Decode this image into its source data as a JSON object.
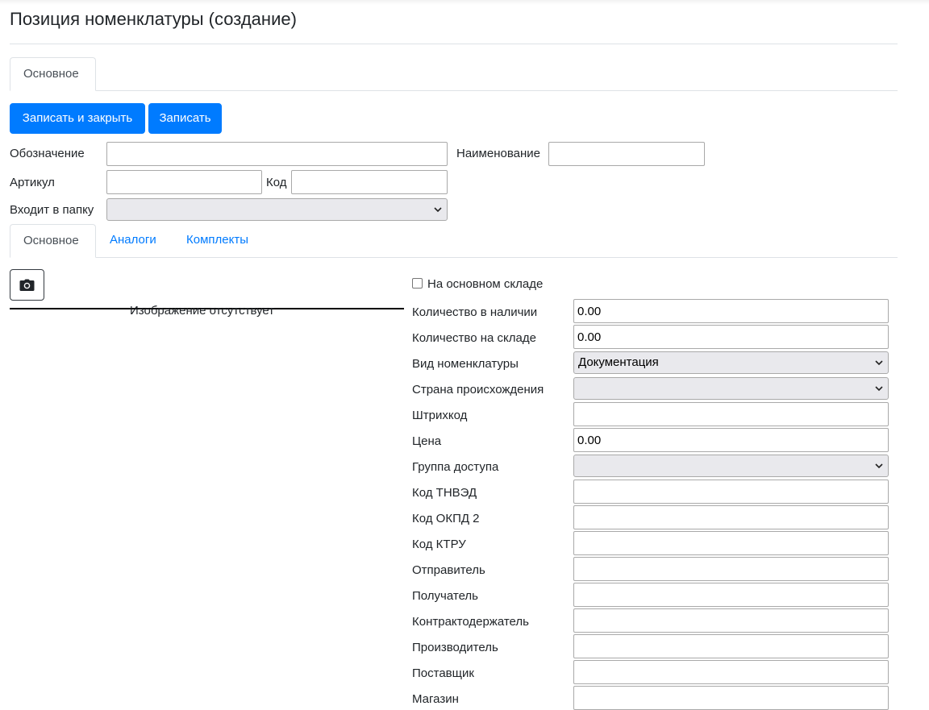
{
  "page": {
    "title": "Позиция номенклатуры (создание)"
  },
  "top_tabs": [
    {
      "label": "Основное"
    }
  ],
  "toolbar": {
    "save_close_label": "Записать и закрыть",
    "save_label": "Записать"
  },
  "header_form": {
    "designation": {
      "label": "Обозначение",
      "value": ""
    },
    "name": {
      "label": "Наименование",
      "value": ""
    },
    "article": {
      "label": "Артикул",
      "value": ""
    },
    "code": {
      "label": "Код",
      "value": ""
    },
    "folder": {
      "label": "Входит в папку",
      "value": ""
    }
  },
  "sub_tabs": [
    {
      "label": "Основное"
    },
    {
      "label": "Аналоги"
    },
    {
      "label": "Комплекты"
    }
  ],
  "image_panel": {
    "camera_icon": "camera-icon",
    "empty_text": "Изображение отсутствует"
  },
  "details": {
    "main_warehouse_label": "На основном складе",
    "main_warehouse_checked": false,
    "fields": [
      {
        "label": "Количество в наличии",
        "type": "input",
        "value": "0.00"
      },
      {
        "label": "Количество на складе",
        "type": "input",
        "value": "0.00"
      },
      {
        "label": "Вид номенклатуры",
        "type": "select",
        "value": "Документация"
      },
      {
        "label": "Страна происхождения",
        "type": "select",
        "value": ""
      },
      {
        "label": "Штрихкод",
        "type": "input",
        "value": ""
      },
      {
        "label": "Цена",
        "type": "input",
        "value": "0.00"
      },
      {
        "label": "Группа доступа",
        "type": "select",
        "value": ""
      },
      {
        "label": "Код ТНВЭД",
        "type": "input",
        "value": ""
      },
      {
        "label": "Код ОКПД 2",
        "type": "input",
        "value": ""
      },
      {
        "label": "Код КТРУ",
        "type": "input",
        "value": ""
      },
      {
        "label": "Отправитель",
        "type": "input",
        "value": ""
      },
      {
        "label": "Получатель",
        "type": "input",
        "value": ""
      },
      {
        "label": "Контрактодержатель",
        "type": "input",
        "value": ""
      },
      {
        "label": "Производитель",
        "type": "input",
        "value": ""
      },
      {
        "label": "Поставщик",
        "type": "input",
        "value": ""
      },
      {
        "label": "Магазин",
        "type": "input",
        "value": ""
      }
    ]
  },
  "colors": {
    "primary": "#007bff",
    "tab_link": "#007bff",
    "border": "#dee2e6",
    "select_bg": "#e9e9ed"
  }
}
